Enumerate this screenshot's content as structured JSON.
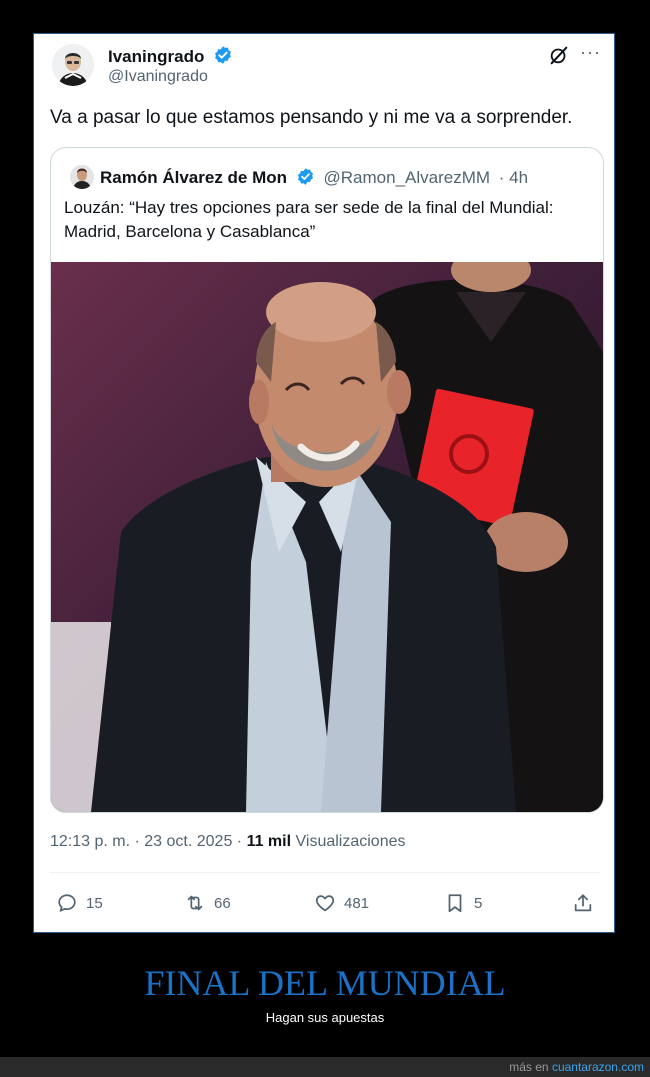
{
  "tweet": {
    "author_name": "Ivaningrado",
    "author_handle": "@Ivaningrado",
    "text": "Va a pasar lo que estamos pensando y ni me va a sorprender.",
    "more_label": "···",
    "icons": {
      "verified": "verified-badge-icon",
      "grok": "grok-icon",
      "more": "more-icon"
    },
    "quote": {
      "author_name": "Ramón Álvarez de Mon",
      "author_handle": "@Ramon_AlvarezMM",
      "time": "· 4h",
      "text": "Louzán: “Hay tres opciones para ser sede de la final del Mundial: Madrid, Barcelona y Casablanca”"
    },
    "timestamp": "12:13 p. m. · 23 oct. 2025 ·",
    "views_count": "11 mil",
    "views_label": "Visualizaciones",
    "actions": {
      "replies": "15",
      "retweets": "66",
      "likes": "481",
      "bookmarks": "5"
    }
  },
  "banner": {
    "title": "FINAL DEL MUNDIAL",
    "subtitle": "Hagan sus apuestas"
  },
  "footer": {
    "prefix": "más en",
    "site": "cuantarazon.com"
  },
  "colors": {
    "verified": "#1d9bf0",
    "banner_title": "#1a73c8",
    "link": "#3ba3ea",
    "card_border": "#2f5c8a"
  }
}
